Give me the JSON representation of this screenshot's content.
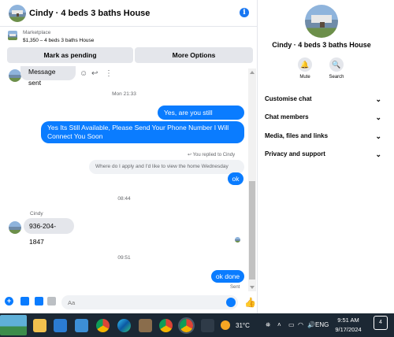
{
  "header": {
    "title": "Cindy · 4 beds 3 baths House",
    "info_icon": "i"
  },
  "listing": {
    "label": "Marketplace",
    "detail": "$1,350 – 4 beds 3 baths House"
  },
  "actions": {
    "mark_pending": "Mark as pending",
    "more_options": "More Options"
  },
  "messages": {
    "sent_incoming": "Message sent",
    "ts1": "Mon 21:33",
    "out1": "Yes, are you still interested?",
    "out2": "Yes Its Still Available, Please Send Your Phone Number I Will Connect You Soon",
    "replied_label": "You replied to Cindy",
    "quoted": "Where do I apply and I'd like to view the home Wednesday",
    "out3": "ok",
    "ts2": "08:44",
    "sender": "Cindy",
    "phone": "936-204-1847",
    "ts3": "09:51",
    "out4": "ok done",
    "sent_status": "Sent"
  },
  "composer": {
    "placeholder": "Aa"
  },
  "right_panel": {
    "title": "Cindy · 4 beds 3 baths House",
    "mute_label": "Mute",
    "search_label": "Search",
    "rows": [
      "Customise chat",
      "Chat members",
      "Media, files and links",
      "Privacy and support"
    ]
  },
  "taskbar": {
    "temperature": "31°C",
    "language": "ENG",
    "time": "9:51 AM",
    "date": "9/17/2024",
    "notifications": "4"
  },
  "colors": {
    "accent": "#0a7cff",
    "bubble_in": "#e4e6eb",
    "taskbar": "#1c2834"
  }
}
